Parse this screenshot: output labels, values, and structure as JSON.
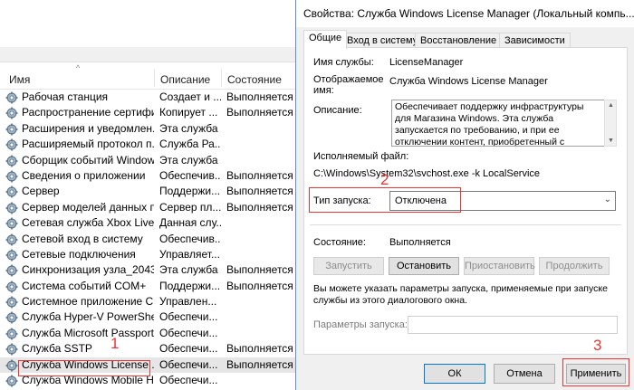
{
  "services_list": {
    "columns": {
      "name": "Имя",
      "description": "Описание",
      "status": "Состояние"
    },
    "rows": [
      {
        "name": "Рабочая станция",
        "description": "Создает и ...",
        "status": "Выполняется"
      },
      {
        "name": "Распространение сертифи...",
        "description": "Копирует ...",
        "status": "Выполняется"
      },
      {
        "name": "Расширения и уведомлен...",
        "description": "Эта служба ...",
        "status": ""
      },
      {
        "name": "Расширяемый протокол п...",
        "description": "Служба Ра...",
        "status": ""
      },
      {
        "name": "Сборщик событий Windows",
        "description": "Эта служба ...",
        "status": ""
      },
      {
        "name": "Сведения о приложении",
        "description": "Обеспечив...",
        "status": "Выполняется"
      },
      {
        "name": "Сервер",
        "description": "Поддержи...",
        "status": "Выполняется"
      },
      {
        "name": "Сервер моделей данных п...",
        "description": "Сервер пл...",
        "status": "Выполняется"
      },
      {
        "name": "Сетевая служба Xbox Live",
        "description": "Данная слу...",
        "status": ""
      },
      {
        "name": "Сетевой вход в систему",
        "description": "Обеспечив...",
        "status": ""
      },
      {
        "name": "Сетевые подключения",
        "description": "Управляет...",
        "status": ""
      },
      {
        "name": "Синхронизация узла_2043...",
        "description": "Эта служба ...",
        "status": "Выполняется"
      },
      {
        "name": "Система событий COM+",
        "description": "Поддержи...",
        "status": "Выполняется"
      },
      {
        "name": "Системное приложение C...",
        "description": "Управлен...",
        "status": ""
      },
      {
        "name": "Служба Hyper-V PowerShe...",
        "description": "Обеспечи...",
        "status": ""
      },
      {
        "name": "Служба Microsoft Passport",
        "description": "Обеспечи...",
        "status": ""
      },
      {
        "name": "Служба SSTP",
        "description": "Обеспечи...",
        "status": "Выполняется"
      },
      {
        "name": "Служба Windows License ...",
        "description": "Обеспечи...",
        "status": "Выполняется",
        "selected": true
      },
      {
        "name": "Служба Windows Mobile H...",
        "description": "Обеспечи...",
        "status": ""
      }
    ]
  },
  "annotations": {
    "marker_1": "1",
    "marker_2": "2",
    "marker_3": "3",
    "color": "#e33333"
  },
  "dialog": {
    "title": "Свойства: Служба Windows License Manager (Локальный компь...",
    "tabs": [
      "Общие",
      "Вход в систему",
      "Восстановление",
      "Зависимости"
    ],
    "active_tab": "Общие",
    "service_name_label": "Имя службы:",
    "service_name": "LicenseManager",
    "display_name_label_1": "Отображаемое",
    "display_name_label_2": "имя:",
    "display_name": "Служба Windows License Manager",
    "description_label": "Описание:",
    "description": "Обеспечивает поддержку инфраструктуры для Магазина Windows. Эта служба запускается по требованию, и при ее отключении контент, приобретенный с помощью Магазина Windows,",
    "exe_label": "Исполняемый файл:",
    "exe_path": "C:\\Windows\\System32\\svchost.exe -k LocalService",
    "startup_type_label": "Тип запуска:",
    "startup_type_value": "Отключена",
    "status_label": "Состояние:",
    "status_value": "Выполняется",
    "buttons": {
      "start": "Запустить",
      "stop": "Остановить",
      "pause": "Приостановить",
      "resume": "Продолжить"
    },
    "params_note": "Вы можете указать параметры запуска, применяемые при запуске службы из этого диалогового окна.",
    "params_label": "Параметры запуска:",
    "params_value": "",
    "footer": {
      "ok": "ОК",
      "cancel": "Отмена",
      "apply": "Применить"
    }
  }
}
